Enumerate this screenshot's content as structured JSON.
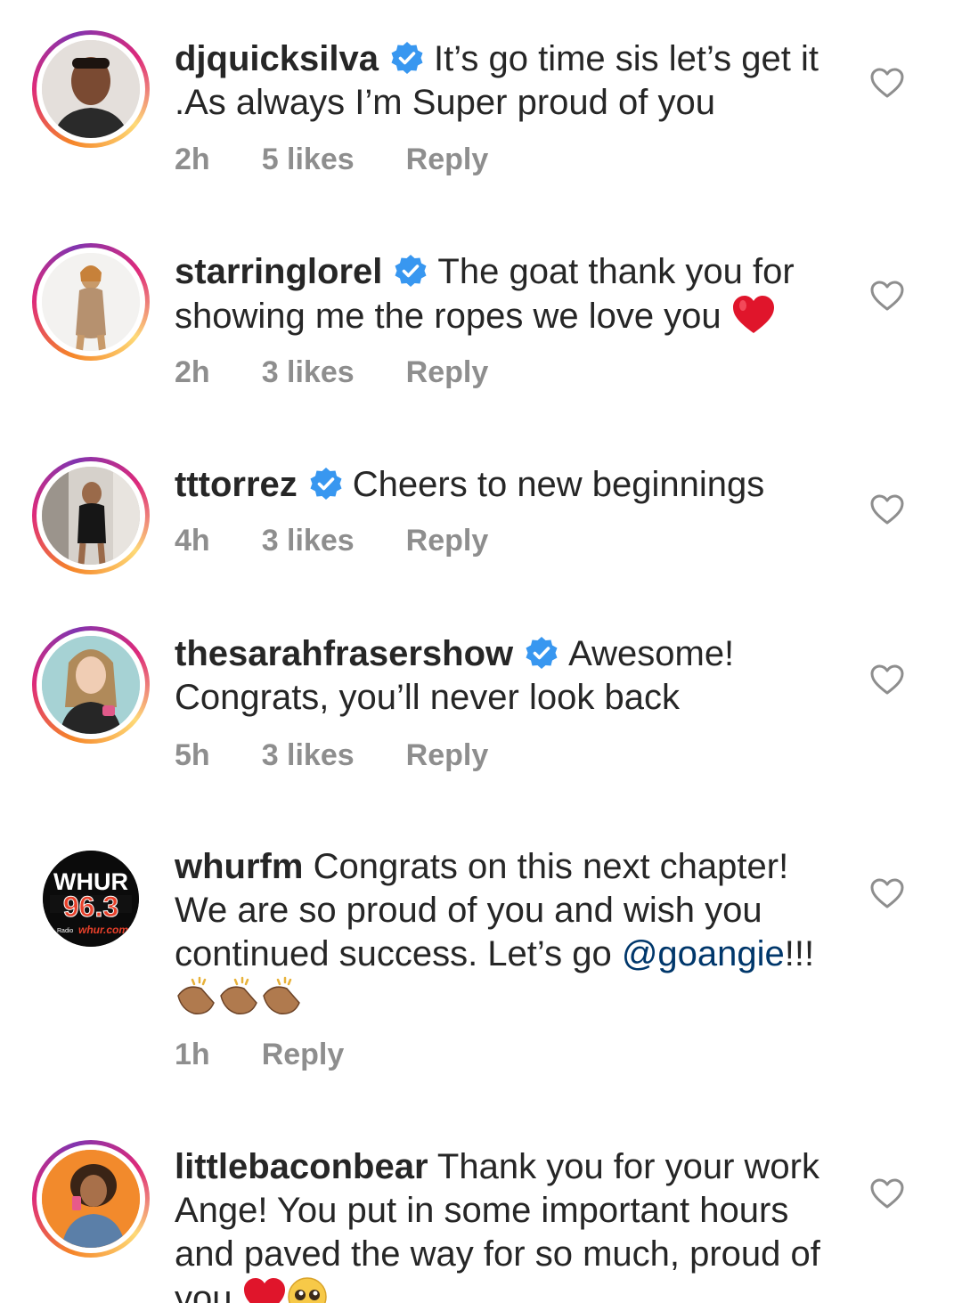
{
  "comments": [
    {
      "username": "djquicksilva",
      "verified": true,
      "text": "It’s go time sis let’s get it .As always I’m Super proud of you",
      "time": "2h",
      "likes": "5 likes",
      "reply": "Reply"
    },
    {
      "username": "starringlorel",
      "verified": true,
      "text": "The goat thank you for showing me the ropes we love you",
      "time": "2h",
      "likes": "3 likes",
      "reply": "Reply"
    },
    {
      "username": "tttorrez",
      "verified": true,
      "text": "Cheers to new beginnings",
      "time": "4h",
      "likes": "3 likes",
      "reply": "Reply"
    },
    {
      "username": "thesarahfrasershow",
      "verified": true,
      "text": "Awesome! Congrats, you’ll never look back",
      "time": "5h",
      "likes": "3 likes",
      "reply": "Reply"
    },
    {
      "username": "whurfm",
      "verified": false,
      "text": "Congrats on this next chapter! We are so proud of you and wish you  continued success. Let’s go",
      "mention": "@goangie",
      "text_after": "!!!",
      "time": "1h",
      "reply": "Reply",
      "avatar_logo": "WHUR",
      "avatar_freq": "96.3",
      "avatar_site": "whur.com",
      "avatar_radio": "Radio"
    },
    {
      "username": "littlebaconbear",
      "verified": false,
      "text": "Thank you for your work Ange! You put in some important hours and paved the way for so much, proud of you"
    }
  ],
  "colors": {
    "verified_badge": "#3897f0",
    "secondary_text": "#8e8e8e",
    "mention": "#00376b",
    "heart_emoji": "#e0152b"
  },
  "icons": {
    "like": "heart-outline-icon",
    "verified": "verified-badge-icon"
  }
}
